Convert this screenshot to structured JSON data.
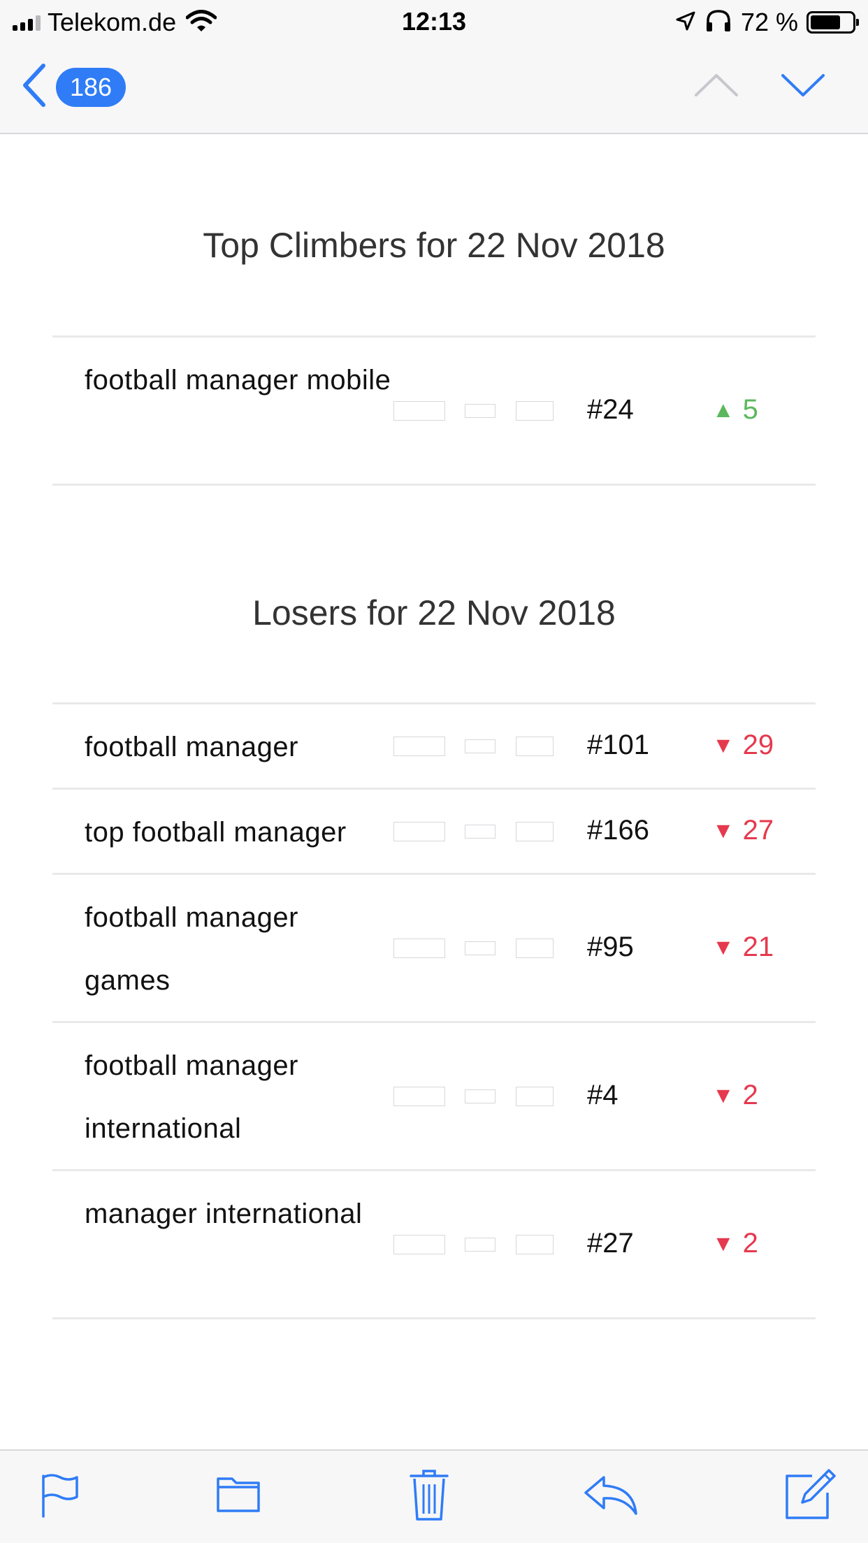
{
  "status_bar": {
    "carrier": "Telekom.de",
    "time": "12:13",
    "battery_percent": "72 %",
    "battery_level": 0.72,
    "signal_bars": 3,
    "icons": [
      "signal-icon",
      "wifi-icon",
      "location-arrow-icon",
      "headphones-icon",
      "battery-icon"
    ]
  },
  "nav": {
    "back_count": "186",
    "icons": [
      "back-chevron-icon",
      "chevron-up-icon",
      "chevron-down-icon"
    ]
  },
  "colors": {
    "accent": "#2f7cf6",
    "up": "#5cb85c",
    "down": "#e5394e",
    "disabled": "#c7c7cc"
  },
  "climbers": {
    "title": "Top Climbers for 22 Nov 2018",
    "rows": [
      {
        "keyword": "football manager mobile",
        "rank": "#24",
        "arrow": "▲",
        "change": "5"
      }
    ]
  },
  "losers": {
    "title": "Losers for 22 Nov 2018",
    "rows": [
      {
        "keyword": "football manager",
        "rank": "#101",
        "arrow": "▼",
        "change": "29"
      },
      {
        "keyword": "top football manager",
        "rank": "#166",
        "arrow": "▼",
        "change": "27"
      },
      {
        "keyword": "football manager games",
        "rank": "#95",
        "arrow": "▼",
        "change": "21"
      },
      {
        "keyword": "football manager international",
        "rank": "#4",
        "arrow": "▼",
        "change": "2"
      },
      {
        "keyword": "manager international",
        "rank": "#27",
        "arrow": "▼",
        "change": "2"
      }
    ]
  },
  "toolbar": {
    "icons": [
      "flag-icon",
      "folder-icon",
      "trash-icon",
      "reply-icon",
      "compose-icon"
    ]
  }
}
